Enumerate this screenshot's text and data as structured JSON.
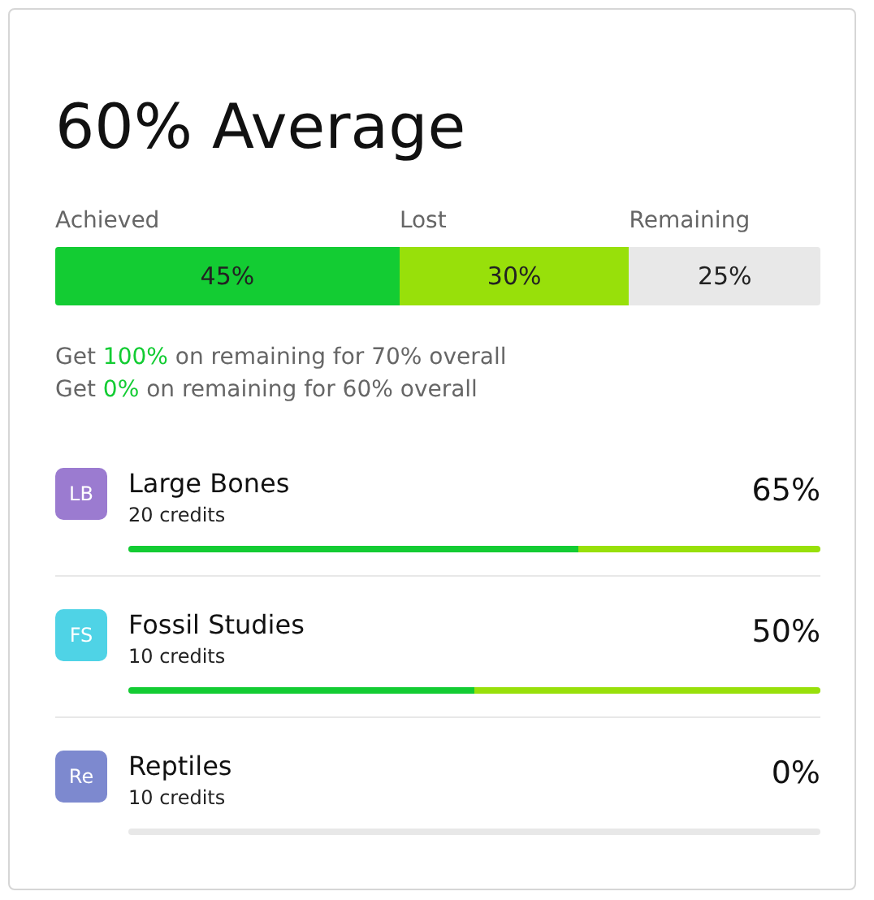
{
  "title": "60% Average",
  "segments": [
    {
      "label": "Achieved",
      "value": "45%",
      "color": "#13cc33"
    },
    {
      "label": "Lost",
      "value": "30%",
      "color": "#98e00a"
    },
    {
      "label": "Remaining",
      "value": "25%",
      "color": "#e8e8e8"
    }
  ],
  "notes": [
    {
      "prefix": "Get ",
      "highlight": "100%",
      "suffix": " on remaining for 70% overall"
    },
    {
      "prefix": "Get ",
      "highlight": "0%",
      "suffix": " on remaining for 60% overall"
    }
  ],
  "courses": [
    {
      "initials": "LB",
      "color": "#9b7bd0",
      "name": "Large Bones",
      "credits": "20 credits",
      "percent": "65%",
      "achieved": {
        "level": 0.65
      },
      "lost": {
        "level": 0.35
      }
    },
    {
      "initials": "FS",
      "color": "#4fd3e6",
      "name": "Fossil Studies",
      "credits": "10 credits",
      "percent": "50%",
      "achieved": {
        "level": 0.5
      },
      "lost": {
        "level": 0.5
      }
    },
    {
      "initials": "Re",
      "color": "#7d89cf",
      "name": "Reptiles",
      "credits": "10 credits",
      "percent": "0%"
    }
  ]
}
